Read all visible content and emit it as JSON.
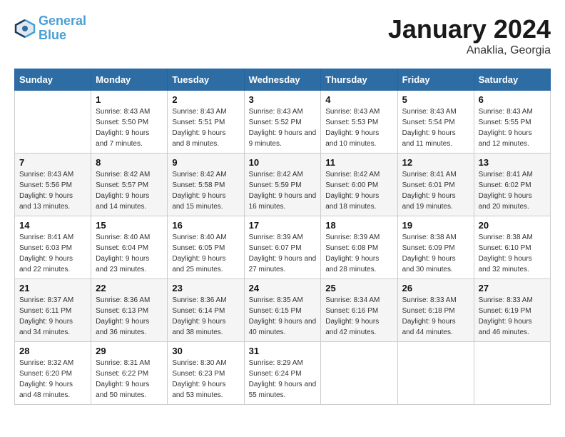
{
  "logo": {
    "line1": "General",
    "line2": "Blue"
  },
  "title": "January 2024",
  "subtitle": "Anaklia, Georgia",
  "header": {
    "days": [
      "Sunday",
      "Monday",
      "Tuesday",
      "Wednesday",
      "Thursday",
      "Friday",
      "Saturday"
    ]
  },
  "weeks": [
    [
      {
        "day": "",
        "sunrise": "",
        "sunset": "",
        "daylight": ""
      },
      {
        "day": "1",
        "sunrise": "Sunrise: 8:43 AM",
        "sunset": "Sunset: 5:50 PM",
        "daylight": "Daylight: 9 hours and 7 minutes."
      },
      {
        "day": "2",
        "sunrise": "Sunrise: 8:43 AM",
        "sunset": "Sunset: 5:51 PM",
        "daylight": "Daylight: 9 hours and 8 minutes."
      },
      {
        "day": "3",
        "sunrise": "Sunrise: 8:43 AM",
        "sunset": "Sunset: 5:52 PM",
        "daylight": "Daylight: 9 hours and 9 minutes."
      },
      {
        "day": "4",
        "sunrise": "Sunrise: 8:43 AM",
        "sunset": "Sunset: 5:53 PM",
        "daylight": "Daylight: 9 hours and 10 minutes."
      },
      {
        "day": "5",
        "sunrise": "Sunrise: 8:43 AM",
        "sunset": "Sunset: 5:54 PM",
        "daylight": "Daylight: 9 hours and 11 minutes."
      },
      {
        "day": "6",
        "sunrise": "Sunrise: 8:43 AM",
        "sunset": "Sunset: 5:55 PM",
        "daylight": "Daylight: 9 hours and 12 minutes."
      }
    ],
    [
      {
        "day": "7",
        "sunrise": "Sunrise: 8:43 AM",
        "sunset": "Sunset: 5:56 PM",
        "daylight": "Daylight: 9 hours and 13 minutes."
      },
      {
        "day": "8",
        "sunrise": "Sunrise: 8:42 AM",
        "sunset": "Sunset: 5:57 PM",
        "daylight": "Daylight: 9 hours and 14 minutes."
      },
      {
        "day": "9",
        "sunrise": "Sunrise: 8:42 AM",
        "sunset": "Sunset: 5:58 PM",
        "daylight": "Daylight: 9 hours and 15 minutes."
      },
      {
        "day": "10",
        "sunrise": "Sunrise: 8:42 AM",
        "sunset": "Sunset: 5:59 PM",
        "daylight": "Daylight: 9 hours and 16 minutes."
      },
      {
        "day": "11",
        "sunrise": "Sunrise: 8:42 AM",
        "sunset": "Sunset: 6:00 PM",
        "daylight": "Daylight: 9 hours and 18 minutes."
      },
      {
        "day": "12",
        "sunrise": "Sunrise: 8:41 AM",
        "sunset": "Sunset: 6:01 PM",
        "daylight": "Daylight: 9 hours and 19 minutes."
      },
      {
        "day": "13",
        "sunrise": "Sunrise: 8:41 AM",
        "sunset": "Sunset: 6:02 PM",
        "daylight": "Daylight: 9 hours and 20 minutes."
      }
    ],
    [
      {
        "day": "14",
        "sunrise": "Sunrise: 8:41 AM",
        "sunset": "Sunset: 6:03 PM",
        "daylight": "Daylight: 9 hours and 22 minutes."
      },
      {
        "day": "15",
        "sunrise": "Sunrise: 8:40 AM",
        "sunset": "Sunset: 6:04 PM",
        "daylight": "Daylight: 9 hours and 23 minutes."
      },
      {
        "day": "16",
        "sunrise": "Sunrise: 8:40 AM",
        "sunset": "Sunset: 6:05 PM",
        "daylight": "Daylight: 9 hours and 25 minutes."
      },
      {
        "day": "17",
        "sunrise": "Sunrise: 8:39 AM",
        "sunset": "Sunset: 6:07 PM",
        "daylight": "Daylight: 9 hours and 27 minutes."
      },
      {
        "day": "18",
        "sunrise": "Sunrise: 8:39 AM",
        "sunset": "Sunset: 6:08 PM",
        "daylight": "Daylight: 9 hours and 28 minutes."
      },
      {
        "day": "19",
        "sunrise": "Sunrise: 8:38 AM",
        "sunset": "Sunset: 6:09 PM",
        "daylight": "Daylight: 9 hours and 30 minutes."
      },
      {
        "day": "20",
        "sunrise": "Sunrise: 8:38 AM",
        "sunset": "Sunset: 6:10 PM",
        "daylight": "Daylight: 9 hours and 32 minutes."
      }
    ],
    [
      {
        "day": "21",
        "sunrise": "Sunrise: 8:37 AM",
        "sunset": "Sunset: 6:11 PM",
        "daylight": "Daylight: 9 hours and 34 minutes."
      },
      {
        "day": "22",
        "sunrise": "Sunrise: 8:36 AM",
        "sunset": "Sunset: 6:13 PM",
        "daylight": "Daylight: 9 hours and 36 minutes."
      },
      {
        "day": "23",
        "sunrise": "Sunrise: 8:36 AM",
        "sunset": "Sunset: 6:14 PM",
        "daylight": "Daylight: 9 hours and 38 minutes."
      },
      {
        "day": "24",
        "sunrise": "Sunrise: 8:35 AM",
        "sunset": "Sunset: 6:15 PM",
        "daylight": "Daylight: 9 hours and 40 minutes."
      },
      {
        "day": "25",
        "sunrise": "Sunrise: 8:34 AM",
        "sunset": "Sunset: 6:16 PM",
        "daylight": "Daylight: 9 hours and 42 minutes."
      },
      {
        "day": "26",
        "sunrise": "Sunrise: 8:33 AM",
        "sunset": "Sunset: 6:18 PM",
        "daylight": "Daylight: 9 hours and 44 minutes."
      },
      {
        "day": "27",
        "sunrise": "Sunrise: 8:33 AM",
        "sunset": "Sunset: 6:19 PM",
        "daylight": "Daylight: 9 hours and 46 minutes."
      }
    ],
    [
      {
        "day": "28",
        "sunrise": "Sunrise: 8:32 AM",
        "sunset": "Sunset: 6:20 PM",
        "daylight": "Daylight: 9 hours and 48 minutes."
      },
      {
        "day": "29",
        "sunrise": "Sunrise: 8:31 AM",
        "sunset": "Sunset: 6:22 PM",
        "daylight": "Daylight: 9 hours and 50 minutes."
      },
      {
        "day": "30",
        "sunrise": "Sunrise: 8:30 AM",
        "sunset": "Sunset: 6:23 PM",
        "daylight": "Daylight: 9 hours and 53 minutes."
      },
      {
        "day": "31",
        "sunrise": "Sunrise: 8:29 AM",
        "sunset": "Sunset: 6:24 PM",
        "daylight": "Daylight: 9 hours and 55 minutes."
      },
      {
        "day": "",
        "sunrise": "",
        "sunset": "",
        "daylight": ""
      },
      {
        "day": "",
        "sunrise": "",
        "sunset": "",
        "daylight": ""
      },
      {
        "day": "",
        "sunrise": "",
        "sunset": "",
        "daylight": ""
      }
    ]
  ]
}
